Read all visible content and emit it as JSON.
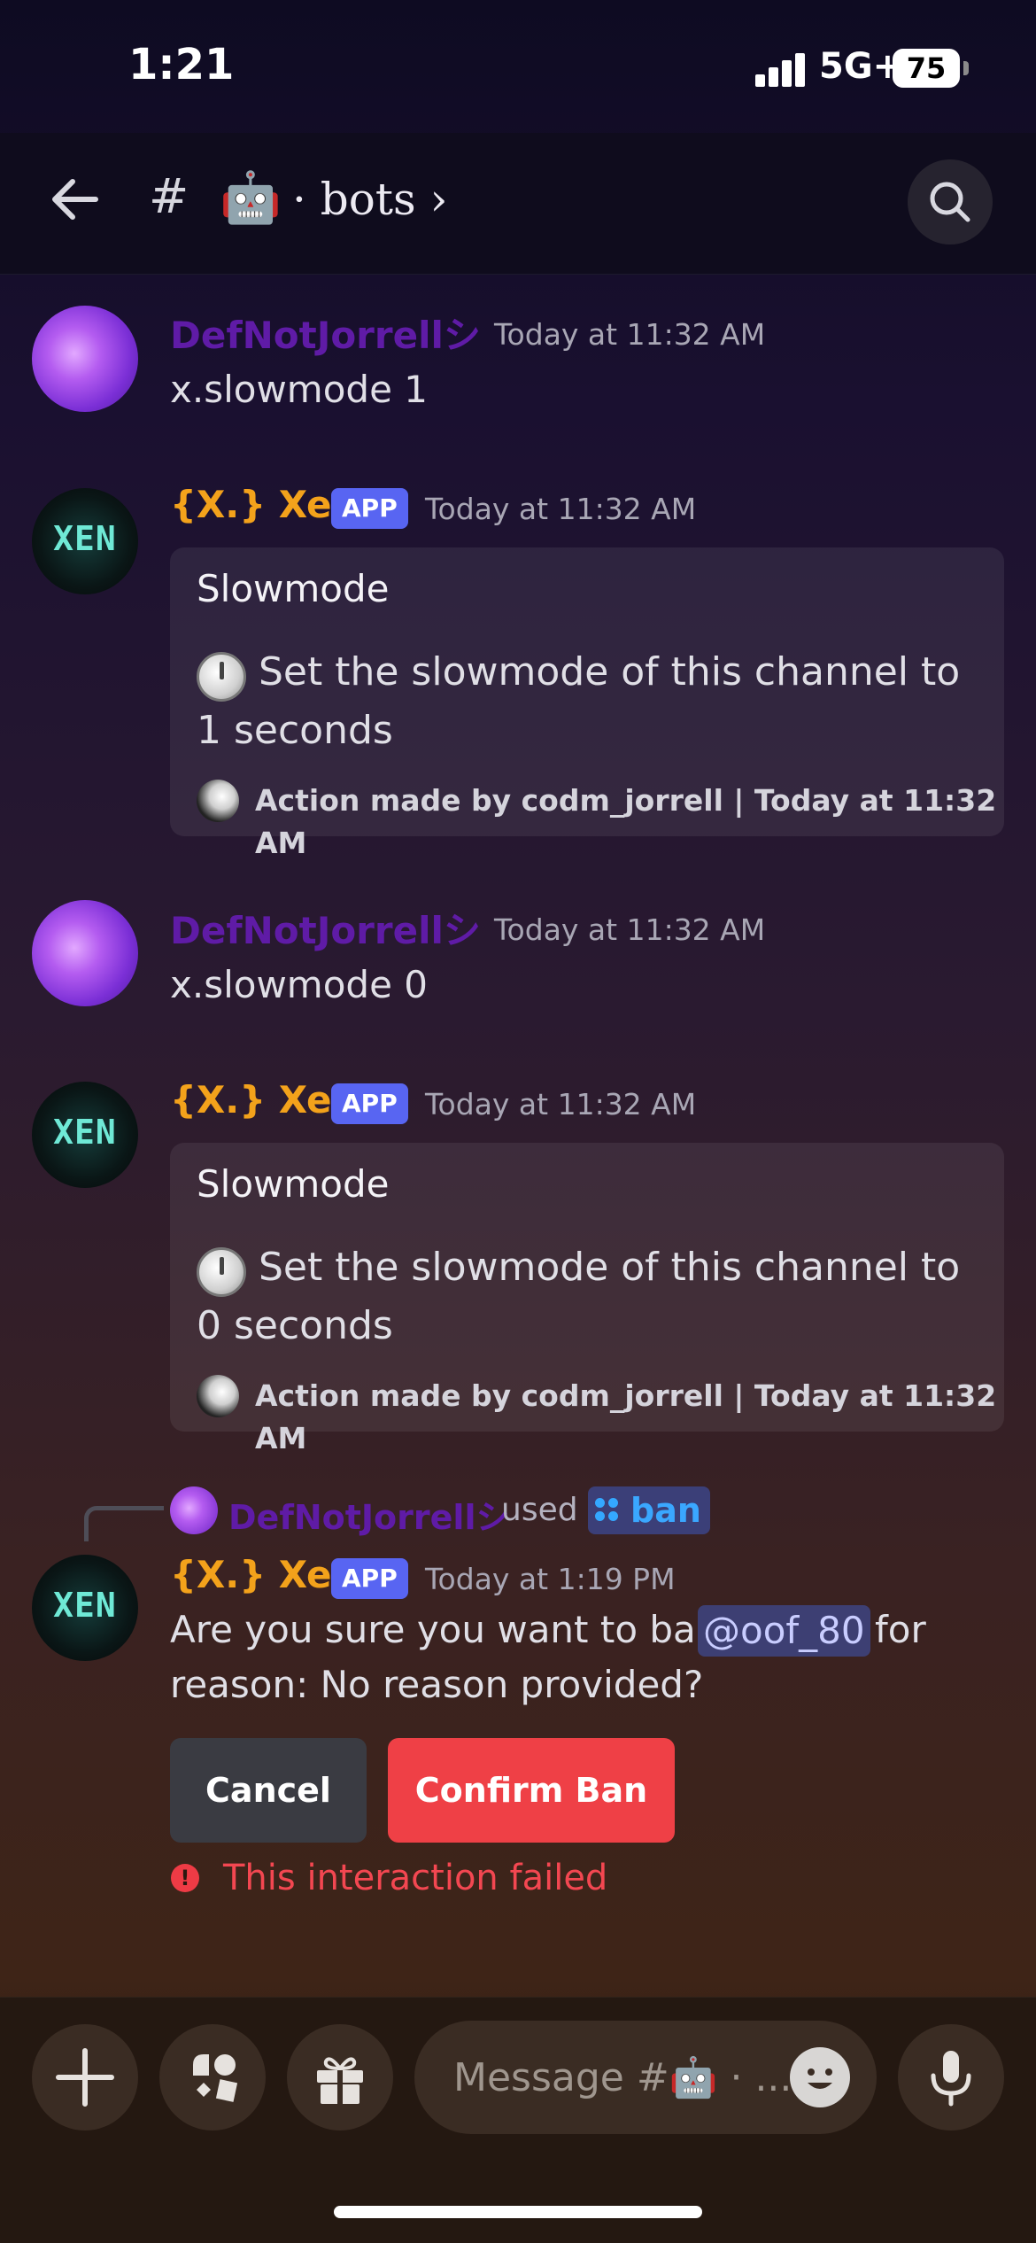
{
  "status": {
    "time": "1:21",
    "network": "5G+",
    "battery": "75"
  },
  "header": {
    "hash": "#",
    "channel_emoji": "🤖",
    "channel_name": "· bots ›"
  },
  "messages": [
    {
      "author": "DefNotJorrellシ",
      "timestamp": "Today at 11:32 AM",
      "text": "x.slowmode 1"
    },
    {
      "author": "{X.} Xen",
      "badge": "APP",
      "timestamp": "Today at 11:32 AM",
      "embed": {
        "title": "Slowmode",
        "description": "Set the slowmode of this channel to 1 seconds",
        "footer": "Action made by codm_jorrell | Today at 11:32 AM"
      }
    },
    {
      "author": "DefNotJorrellシ",
      "timestamp": "Today at 11:32 AM",
      "text": "x.slowmode 0"
    },
    {
      "author": "{X.} Xen",
      "badge": "APP",
      "timestamp": "Today at 11:32 AM",
      "embed": {
        "title": "Slowmode",
        "description": "Set the slowmode of this channel to 0 seconds",
        "footer": "Action made by codm_jorrell | Today at 11:32 AM"
      }
    },
    {
      "reply_author": "DefNotJorrellシ",
      "reply_used": "used",
      "reply_command": "ban",
      "author": "{X.} Xen",
      "badge": "APP",
      "timestamp": "Today at 1:19 PM",
      "text_before": "Are you sure you want to ban",
      "mention": "@oof_80",
      "text_after": "for",
      "text_line2": "reason: No reason provided?",
      "buttons": {
        "cancel": "Cancel",
        "confirm": "Confirm Ban"
      },
      "error": "This interaction failed"
    }
  ],
  "composer": {
    "placeholder": "Message #🤖 · ..."
  },
  "icons": [
    "back-arrow-icon",
    "search-icon",
    "timer-icon",
    "slash-command-icon",
    "plus-icon",
    "apps-icon",
    "gift-icon",
    "emoji-icon",
    "microphone-icon"
  ],
  "colors": {
    "user_name": "#5f1ba6",
    "bot_name": "#f3a21b",
    "app_badge": "#5865f2",
    "confirm": "#ef4046",
    "error": "#f34751"
  }
}
